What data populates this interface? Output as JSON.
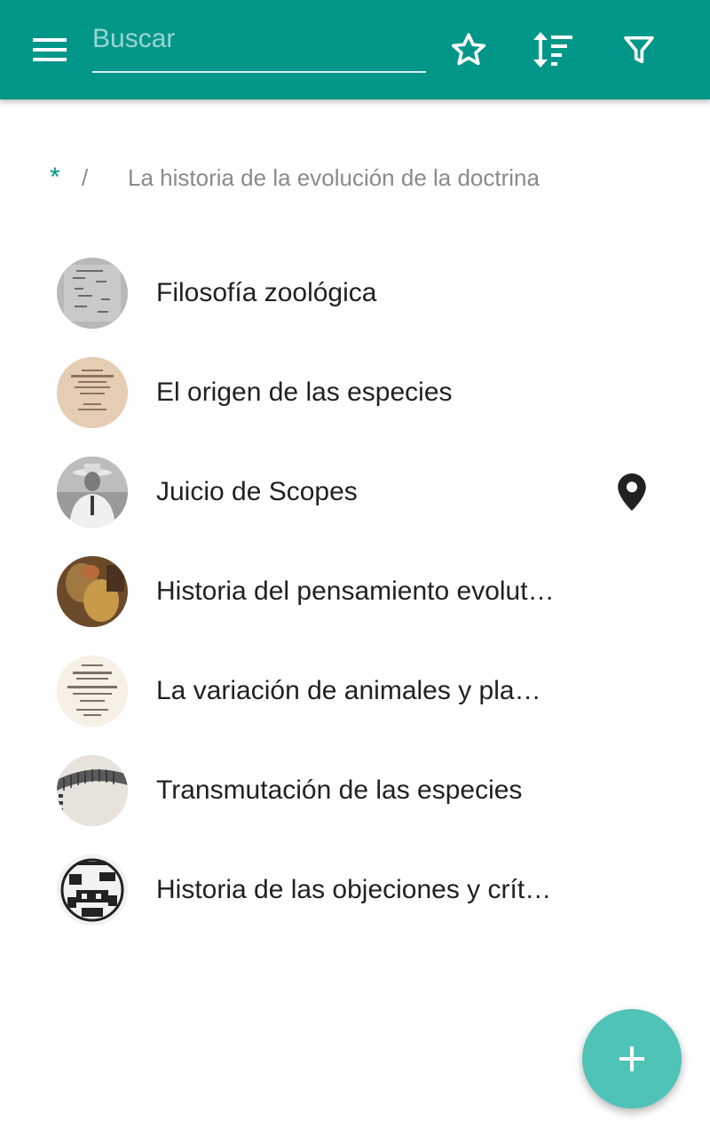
{
  "appbar": {
    "background": "#009688",
    "menu_icon": "hamburger-menu-icon",
    "search": {
      "value": "",
      "placeholder": "Buscar"
    },
    "actions": [
      {
        "name": "favorites",
        "icon": "star-outline-icon"
      },
      {
        "name": "sort",
        "icon": "sort-icon"
      },
      {
        "name": "filter",
        "icon": "filter-icon"
      }
    ]
  },
  "breadcrumb": {
    "root": "*",
    "separator": "/",
    "current": "La historia de la evolución de la doctrina",
    "accent": "#009688"
  },
  "items": [
    {
      "title": "Filosofía zoológica",
      "thumb": "old-printed-page"
    },
    {
      "title": "El origen de las especies",
      "thumb": "book-title-page"
    },
    {
      "title": "Juicio de Scopes",
      "thumb": "man-with-hat-photo",
      "has_location": true,
      "location_icon": "map-pin-icon"
    },
    {
      "title": "Historia del pensamiento evolutivo",
      "thumb": "classical-painting"
    },
    {
      "title": "La variación de animales y plantas",
      "thumb": "book-title-page"
    },
    {
      "title": "Transmutación de las especies",
      "thumb": "skeleton-illustration"
    },
    {
      "title": "Historia de las objeciones y críticas",
      "thumb": "engraving-illustration"
    }
  ],
  "fab": {
    "icon": "plus-icon",
    "color": "#4fc3b6"
  }
}
